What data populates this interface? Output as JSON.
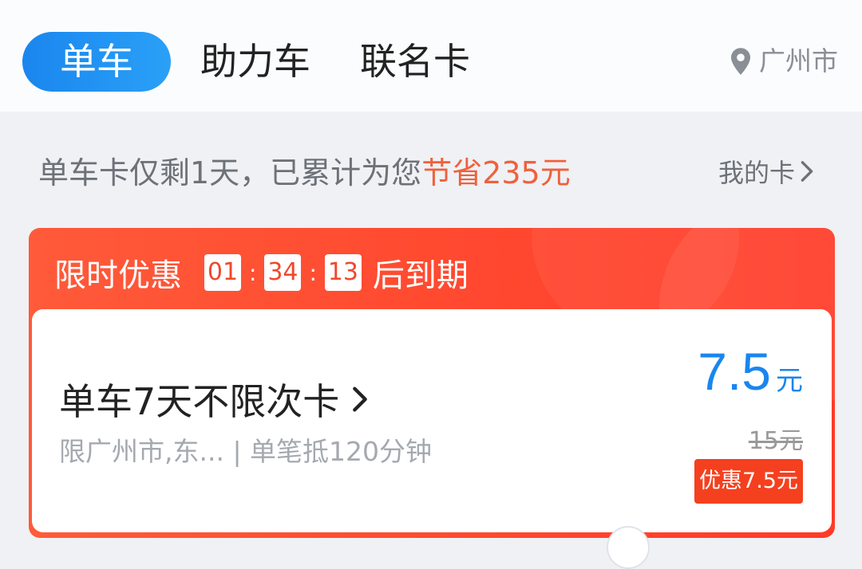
{
  "tabs": [
    {
      "label": "单车"
    },
    {
      "label": "助力车"
    },
    {
      "label": "联名卡"
    }
  ],
  "location": {
    "city": "广州市",
    "icon": "location-pin-icon"
  },
  "notice": {
    "prefix": "单车卡仅剩1天，已累计为您",
    "highlight": "节省235元",
    "my_cards_label": "我的卡"
  },
  "promo": {
    "label": "限时优惠",
    "countdown": {
      "hours": "01",
      "minutes": "34",
      "seconds": "13"
    },
    "separator": ":",
    "suffix": "后到期",
    "card": {
      "title": "单车7天不限次卡",
      "subtitle": "限广州市,东... | 单笔抵120分钟",
      "price": "7.5",
      "price_unit": "元",
      "original_price": "15元",
      "discount_badge": "优惠7.5元"
    }
  },
  "colors": {
    "accent_blue": "#1a86ee",
    "promo_red": "#ff4a30",
    "highlight_orange": "#f0603c"
  }
}
